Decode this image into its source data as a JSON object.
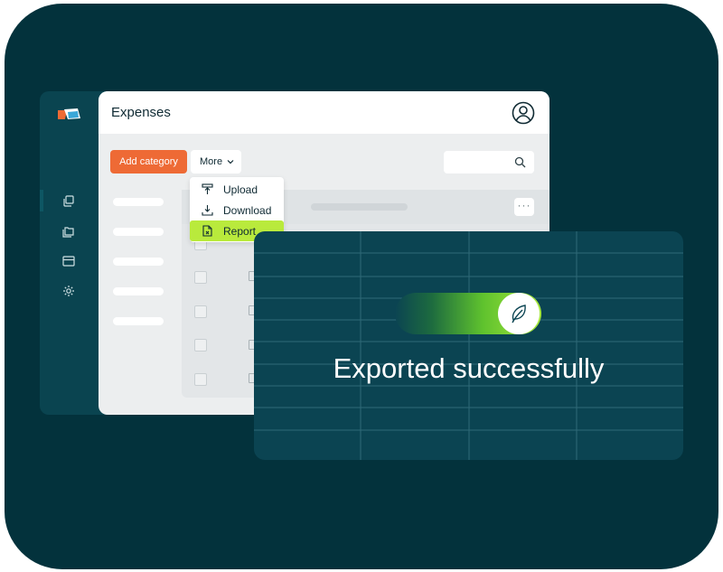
{
  "app": {
    "title": "Expenses"
  },
  "toolbar": {
    "add_label": "Add category",
    "more_label": "More",
    "search_placeholder": ""
  },
  "menu": {
    "items": [
      {
        "label": "Upload",
        "icon": "upload-icon"
      },
      {
        "label": "Download",
        "icon": "download-icon"
      },
      {
        "label": "Report",
        "icon": "report-icon",
        "selected": true
      }
    ]
  },
  "table": {
    "row_action": "···"
  },
  "toast": {
    "message": "Exported successfully",
    "icon": "leaf-icon"
  },
  "colors": {
    "background": "#03323c",
    "accent_orange": "#ee6a35",
    "accent_lime": "#b9ea3c",
    "panel": "#0b4452"
  },
  "icons": {
    "sidebar": [
      "layers-icon",
      "folders-icon",
      "card-icon",
      "settings-icon"
    ],
    "header": "user-icon",
    "search": "search-icon"
  }
}
